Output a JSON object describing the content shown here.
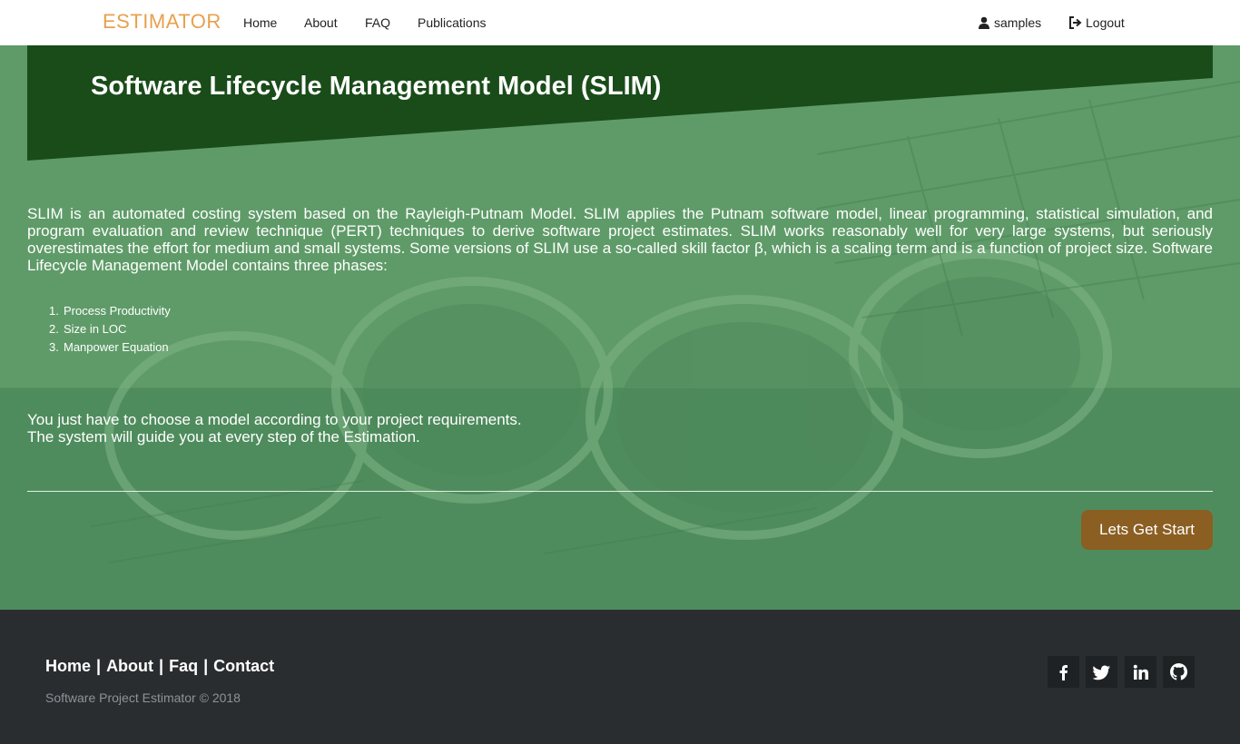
{
  "navbar": {
    "brand": "ESTIMATOR",
    "links": [
      "Home",
      "About",
      "FAQ",
      "Publications"
    ],
    "user": "samples",
    "logout": "Logout"
  },
  "hero": {
    "title": "Software Lifecycle Management Model (SLIM)"
  },
  "content": {
    "intro": "SLIM is an automated costing system based on the Rayleigh-Putnam Model. SLIM applies the Putnam software model, linear programming, statistical simulation, and program evaluation and review technique (PERT) techniques to derive software project estimates. SLIM works reasonably well for very large systems, but seriously overestimates the effort for medium and small systems. Some versions of SLIM use a so-called skill factor β, which is a scaling term and is a function of project size. Software Lifecycle Management Model contains three phases:",
    "phases": [
      "Process Productivity",
      "Size in LOC",
      "Manpower Equation"
    ],
    "guide_line1": "You just have to choose a model according to your project requirements.",
    "guide_line2": "The system will guide you at every step of the Estimation.",
    "cta_label": "Lets Get Start"
  },
  "footer": {
    "links": [
      "Home",
      "About",
      "Faq",
      "Contact"
    ],
    "separator": "|",
    "copyright": "Software Project Estimator © 2018",
    "social_icons": [
      "facebook-icon",
      "twitter-icon",
      "linkedin-icon",
      "github-icon"
    ]
  },
  "colors": {
    "brand": "#e8a14d",
    "hero": "#1a4c19",
    "background": "#5d9a66",
    "cta": "#8b5e22",
    "footer": "#2a2d30"
  }
}
